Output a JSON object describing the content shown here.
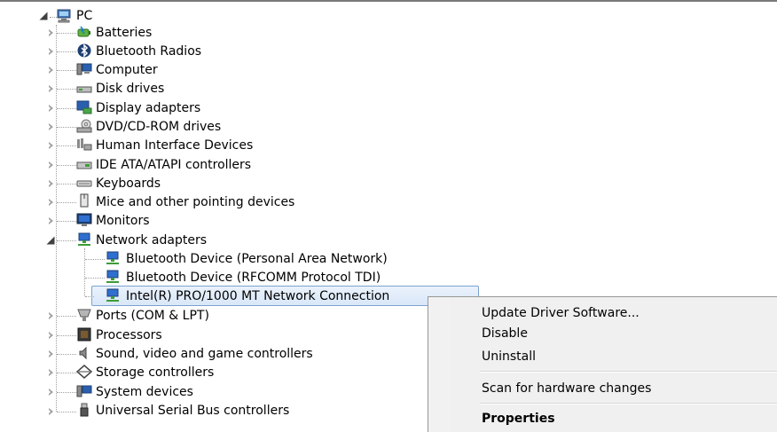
{
  "root": {
    "label": "PC"
  },
  "categories": [
    {
      "label": "Batteries",
      "icon": "battery-icon"
    },
    {
      "label": "Bluetooth Radios",
      "icon": "bluetooth-icon"
    },
    {
      "label": "Computer",
      "icon": "computer-icon"
    },
    {
      "label": "Disk drives",
      "icon": "disk-drive-icon"
    },
    {
      "label": "Display adapters",
      "icon": "display-adapter-icon"
    },
    {
      "label": "DVD/CD-ROM drives",
      "icon": "dvd-drive-icon"
    },
    {
      "label": "Human Interface Devices",
      "icon": "hid-icon"
    },
    {
      "label": "IDE ATA/ATAPI controllers",
      "icon": "ide-controller-icon"
    },
    {
      "label": "Keyboards",
      "icon": "keyboard-icon"
    },
    {
      "label": "Mice and other pointing devices",
      "icon": "mouse-icon"
    },
    {
      "label": "Monitors",
      "icon": "monitor-icon"
    },
    {
      "label": "Network adapters",
      "icon": "network-adapter-icon"
    },
    {
      "label": "Ports (COM & LPT)",
      "icon": "port-icon"
    },
    {
      "label": "Processors",
      "icon": "processor-icon"
    },
    {
      "label": "Sound, video and game controllers",
      "icon": "sound-icon"
    },
    {
      "label": "Storage controllers",
      "icon": "storage-icon"
    },
    {
      "label": "System devices",
      "icon": "system-device-icon"
    },
    {
      "label": "Universal Serial Bus controllers",
      "icon": "usb-icon"
    }
  ],
  "network_children": [
    {
      "label": "Bluetooth Device (Personal Area Network)"
    },
    {
      "label": "Bluetooth Device (RFCOMM Protocol TDI)"
    },
    {
      "label": "Intel(R) PRO/1000 MT Network Connection"
    }
  ],
  "context_menu": {
    "update_driver": "Update Driver Software...",
    "disable": "Disable",
    "uninstall": "Uninstall",
    "scan": "Scan for hardware changes",
    "properties": "Properties"
  }
}
